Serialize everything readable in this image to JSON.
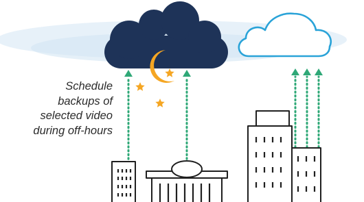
{
  "caption": {
    "lines": [
      "Schedule",
      "backups of",
      "selected video",
      "during off-hours"
    ]
  },
  "colors": {
    "night_cloud": "#1e3358",
    "glow": "#d3e6f4",
    "day_cloud_outline": "#2aa3d8",
    "moon": "#f5a623",
    "arrow": "#2fa877",
    "building_outline": "#1f1f1f"
  },
  "icons": {
    "night_cloud": "night-cloud-icon",
    "moon": "crescent-moon-icon",
    "stars": "star-icon",
    "day_cloud": "cloud-outline-icon",
    "buildings": "building-icon"
  }
}
